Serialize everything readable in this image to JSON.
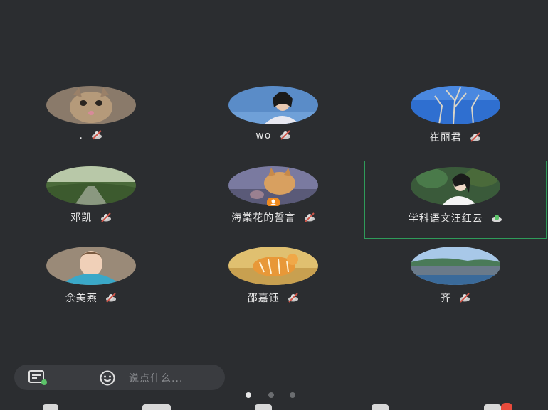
{
  "participants": [
    {
      "name": ".",
      "mic": "muted"
    },
    {
      "name": "wo",
      "mic": "muted"
    },
    {
      "name": "崔丽君",
      "mic": "muted"
    },
    {
      "name": "邓凯",
      "mic": "muted"
    },
    {
      "name": "海棠花的誓言",
      "mic": "muted",
      "host": true
    },
    {
      "name": "学科语文汪红云",
      "mic": "active",
      "speaking": true
    },
    {
      "name": "余美燕",
      "mic": "muted"
    },
    {
      "name": "邵嘉钰",
      "mic": "muted"
    },
    {
      "name": "齐",
      "mic": "muted"
    }
  ],
  "chat": {
    "placeholder": "说点什么..."
  },
  "pager": {
    "total": 3,
    "active": 1
  },
  "colors": {
    "background": "#2b2d30",
    "speaking_border": "#2f9b5a",
    "host_badge": "#f08b1e",
    "muted_icon": "#d0564a",
    "active_mic": "#5cc46a",
    "notification": "#e94b3c"
  }
}
